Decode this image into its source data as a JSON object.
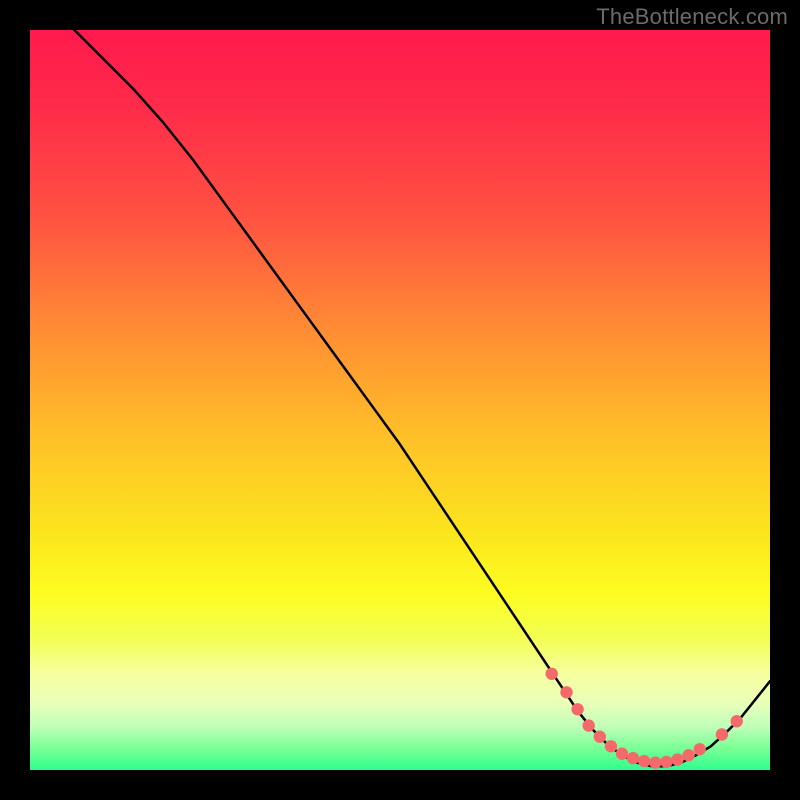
{
  "watermark": "TheBottleneck.com",
  "colors": {
    "background": "#000000",
    "curve_stroke": "#000000",
    "marker_fill": "#f46a6a",
    "marker_stroke": "#f46a6a"
  },
  "chart_data": {
    "type": "line",
    "title": "",
    "xlabel": "",
    "ylabel": "",
    "xlim": [
      0,
      100
    ],
    "ylim": [
      0,
      100
    ],
    "grid": false,
    "legend": false,
    "series": [
      {
        "name": "bottleneck-curve",
        "x": [
          6,
          10,
          14,
          18,
          22,
          26,
          30,
          34,
          38,
          42,
          46,
          50,
          54,
          58,
          62,
          66,
          70,
          72,
          74,
          76,
          78,
          80,
          82,
          84,
          86,
          88,
          90,
          92,
          94,
          96,
          100
        ],
        "y": [
          100,
          96,
          92,
          87.5,
          82.5,
          77,
          71.5,
          66,
          60.5,
          55,
          49.5,
          44,
          38,
          32,
          26,
          20,
          14,
          11,
          8,
          5.5,
          3.5,
          2,
          1,
          0.5,
          0.5,
          1,
          2,
          3.2,
          5,
          7,
          12
        ]
      }
    ],
    "markers": {
      "name": "highlight-points",
      "x": [
        70.5,
        72.5,
        74,
        75.5,
        77,
        78.5,
        80,
        81.5,
        83,
        84.5,
        86,
        87.5,
        89,
        90.5,
        93.5,
        95.5
      ],
      "y": [
        13,
        10.5,
        8.2,
        6,
        4.5,
        3.2,
        2.2,
        1.6,
        1.2,
        1,
        1.1,
        1.4,
        2,
        2.8,
        4.8,
        6.6
      ]
    }
  }
}
